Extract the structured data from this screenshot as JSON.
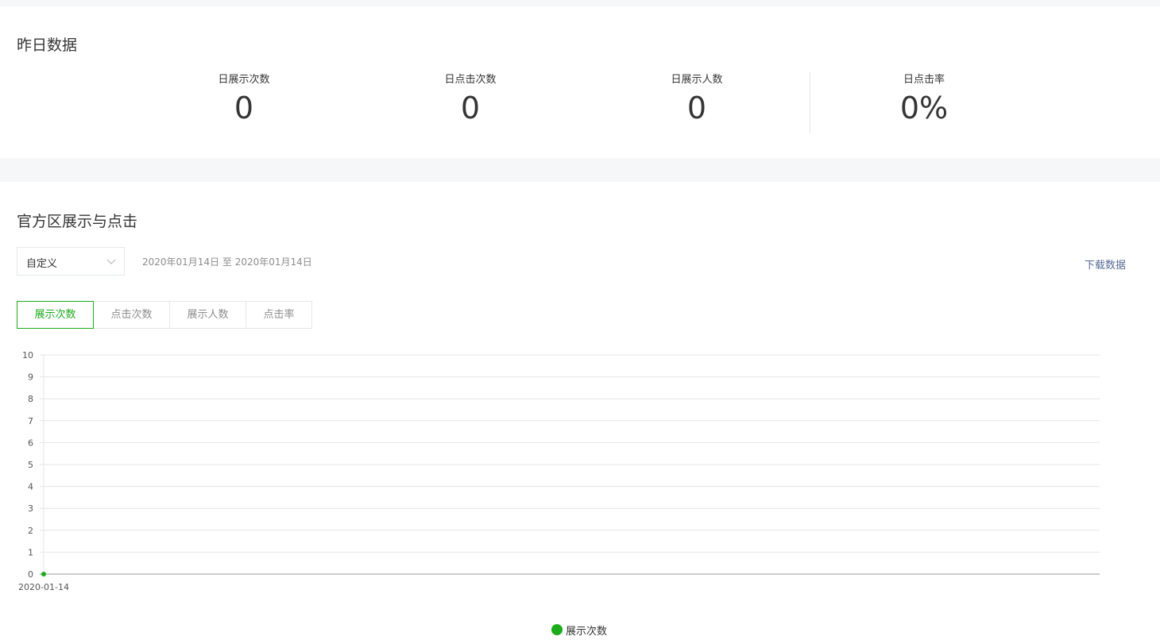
{
  "yesterday": {
    "title": "昨日数据",
    "stats": [
      {
        "label": "日展示次数",
        "value": "0"
      },
      {
        "label": "日点击次数",
        "value": "0"
      },
      {
        "label": "日展示人数",
        "value": "0"
      },
      {
        "label": "日点击率",
        "value": "0%"
      }
    ]
  },
  "chart_section": {
    "title": "官方区展示与点击",
    "range_select": {
      "value": "自定义",
      "icon": "chevron-down-icon"
    },
    "date_range": "2020年01月14日 至 2020年01月14日",
    "download_label": "下载数据",
    "tabs": [
      {
        "label": "展示次数",
        "active": true
      },
      {
        "label": "点击次数",
        "active": false
      },
      {
        "label": "展示人数",
        "active": false
      },
      {
        "label": "点击率",
        "active": false
      }
    ],
    "accent_color": "#1aad19",
    "link_color": "#576b95"
  },
  "chart_data": {
    "type": "line",
    "x": [
      "2020-01-14"
    ],
    "series": [
      {
        "name": "展示次数",
        "values": [
          0
        ],
        "color": "#1aad19"
      }
    ],
    "ylim": [
      0,
      10
    ],
    "yticks": [
      0,
      1,
      2,
      3,
      4,
      5,
      6,
      7,
      8,
      9,
      10
    ],
    "grid": true,
    "legend_position": "bottom-center"
  }
}
